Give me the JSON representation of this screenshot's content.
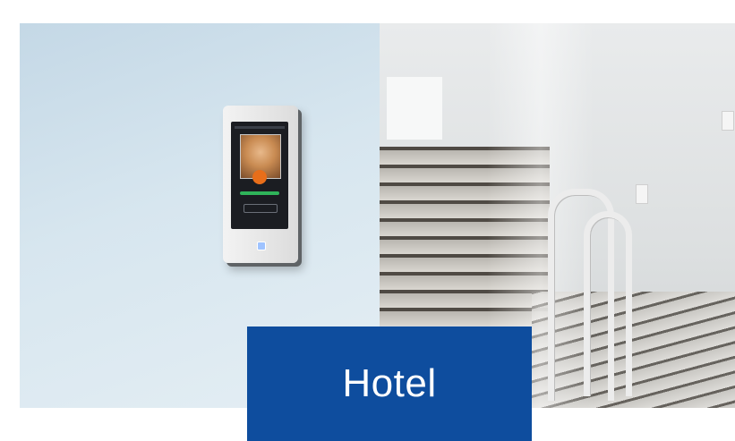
{
  "caption": {
    "label": "Hotel"
  },
  "colors": {
    "caption_background": "#0e4d9e",
    "caption_text": "#ffffff"
  },
  "image": {
    "description_icons": [
      "face-recognition-terminal-icon"
    ]
  }
}
